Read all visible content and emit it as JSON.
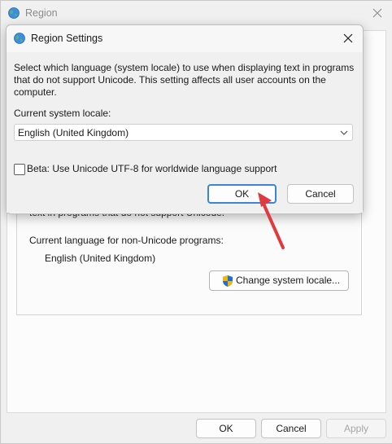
{
  "back_window": {
    "title": "Region",
    "partial_text": "text in programs that do not support Unicode.",
    "current_language_label": "Current language for non-Unicode programs:",
    "current_language_value": "English (United Kingdom)",
    "change_locale_label": "Change system locale...",
    "ok_label": "OK",
    "cancel_label": "Cancel",
    "apply_label": "Apply"
  },
  "dialog": {
    "title": "Region Settings",
    "description": "Select which language (system locale) to use when displaying text in programs that do not support Unicode. This setting affects all user accounts on the computer.",
    "locale_label": "Current system locale:",
    "locale_value": "English (United Kingdom)",
    "beta_label": "Beta: Use Unicode UTF-8 for worldwide language support",
    "beta_checked": false,
    "ok_label": "OK",
    "cancel_label": "Cancel"
  },
  "icons": {
    "window_icon": "globe-icon",
    "dialog_icon": "globe-icon",
    "close": "close-icon",
    "dropdown": "chevron-down-icon",
    "uac": "uac-shield-icon",
    "annotation": "red-arrow-icon"
  },
  "colors": {
    "accent": "#3b84d6",
    "annotation_arrow": "#e0393e"
  }
}
